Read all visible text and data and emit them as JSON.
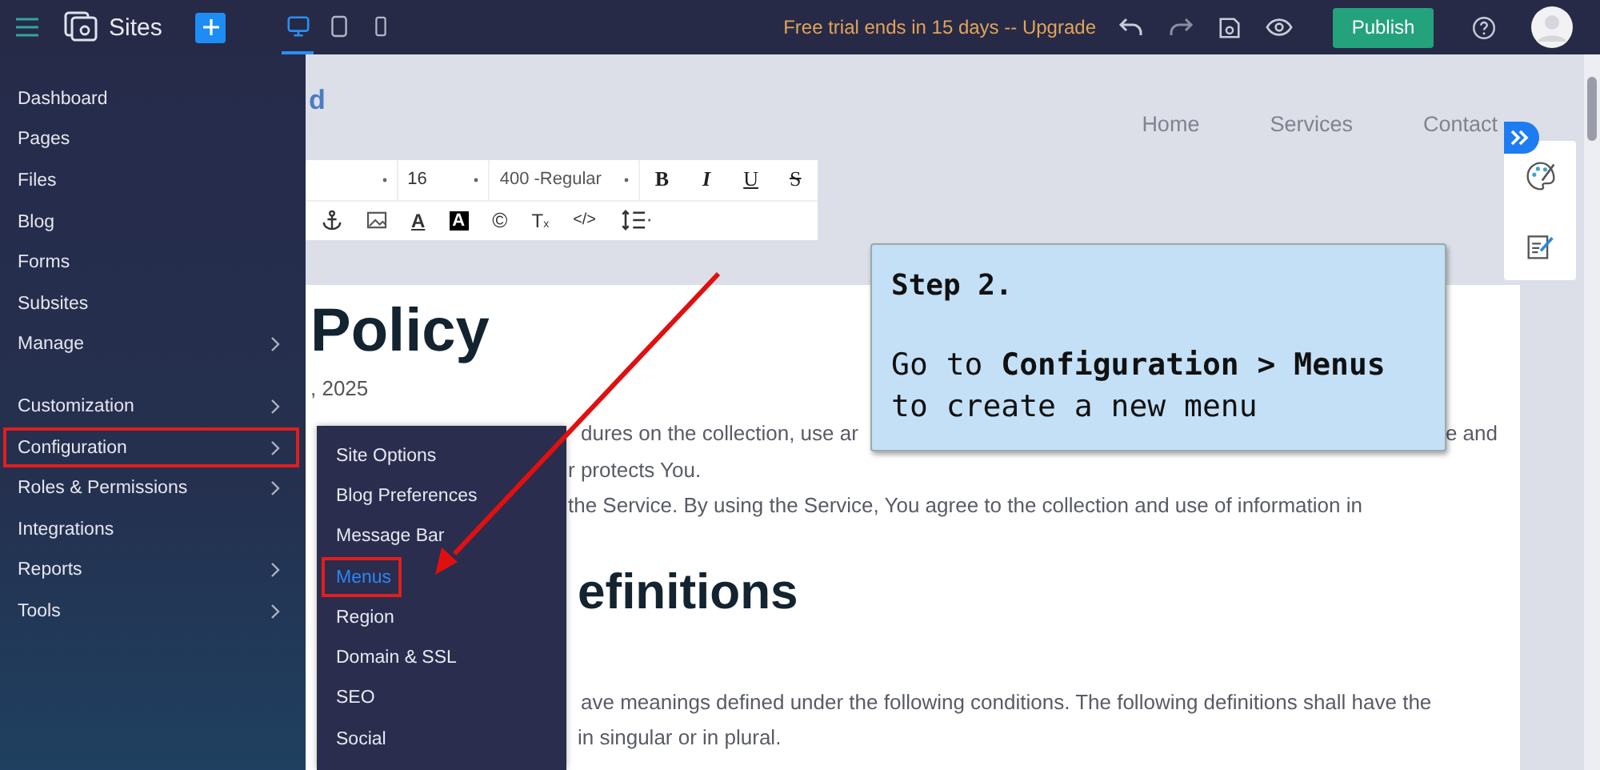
{
  "topbar": {
    "app_name": "Sites",
    "device_modes": [
      {
        "kind": "desktop",
        "selected": true
      },
      {
        "kind": "tablet",
        "selected": false
      },
      {
        "kind": "mobile",
        "selected": false
      }
    ],
    "trial_notice": "Free trial ends in 15 days -- Upgrade",
    "publish": "Publish"
  },
  "sidebar": {
    "sections": [
      {
        "items": [
          {
            "label": "Dashboard",
            "has_submenu": false,
            "highlighted": false
          },
          {
            "label": "Pages",
            "has_submenu": false,
            "highlighted": false
          },
          {
            "label": "Files",
            "has_submenu": false,
            "highlighted": false
          },
          {
            "label": "Blog",
            "has_submenu": false,
            "highlighted": false
          },
          {
            "label": "Forms",
            "has_submenu": false,
            "highlighted": false
          },
          {
            "label": "Subsites",
            "has_submenu": false,
            "highlighted": false
          },
          {
            "label": "Manage",
            "has_submenu": true,
            "highlighted": false
          }
        ]
      },
      {
        "items": [
          {
            "label": "Customization",
            "has_submenu": true,
            "highlighted": false
          },
          {
            "label": "Configuration",
            "has_submenu": true,
            "highlighted": true
          },
          {
            "label": "Roles & Permissions",
            "has_submenu": true,
            "highlighted": false
          },
          {
            "label": "Integrations",
            "has_submenu": false,
            "highlighted": false
          },
          {
            "label": "Reports",
            "has_submenu": true,
            "highlighted": false
          },
          {
            "label": "Tools",
            "has_submenu": true,
            "highlighted": false
          }
        ]
      }
    ]
  },
  "submenu": {
    "items": [
      {
        "label": "Site Options",
        "selected": false,
        "highlighted": false
      },
      {
        "label": "Blog Preferences",
        "selected": false,
        "highlighted": false
      },
      {
        "label": "Message Bar",
        "selected": false,
        "highlighted": false
      },
      {
        "label": "Menus",
        "selected": true,
        "highlighted": true
      },
      {
        "label": "Region",
        "selected": false,
        "highlighted": false
      },
      {
        "label": "Domain & SSL",
        "selected": false,
        "highlighted": false
      },
      {
        "label": "SEO",
        "selected": false,
        "highlighted": false
      },
      {
        "label": "Social",
        "selected": false,
        "highlighted": false
      }
    ]
  },
  "site_header": {
    "logo_fragment": "d",
    "nav": [
      "Home",
      "Services",
      "Contact"
    ]
  },
  "editor_toolbar": {
    "font_size": "16",
    "font_weight": "400 -Regular",
    "format_buttons": [
      {
        "kind": "bold",
        "label": "B"
      },
      {
        "kind": "italic",
        "label": "I"
      },
      {
        "kind": "underline",
        "label": "U"
      },
      {
        "kind": "strike",
        "label": "S"
      }
    ],
    "tools": [
      {
        "kind": "anchor"
      },
      {
        "kind": "image"
      },
      {
        "kind": "text-color",
        "glyph": "A"
      },
      {
        "kind": "background-color",
        "glyph": "A"
      },
      {
        "kind": "copyright",
        "glyph": "©"
      },
      {
        "kind": "clear-format",
        "glyph": "T",
        "sub": "x"
      },
      {
        "kind": "code",
        "glyph": "</>"
      },
      {
        "kind": "line-height"
      }
    ]
  },
  "page": {
    "heading": "Policy",
    "date": ", 2025",
    "lines": [
      {
        "left": "dures on the collection, use ar",
        "right": "e and"
      },
      {
        "left": "r protects You."
      },
      {
        "left": "the Service. By using the Service, You agree to the collection and use of information in"
      }
    ],
    "heading2": "efinitions",
    "lines2": [
      {
        "left": "ave meanings defined under the following conditions. The following definitions shall have the"
      },
      {
        "left": "in singular or in plural."
      }
    ]
  },
  "callout": {
    "title": "Step 2.",
    "body": "Go to **Configuration > Menus** to create a new menu"
  }
}
